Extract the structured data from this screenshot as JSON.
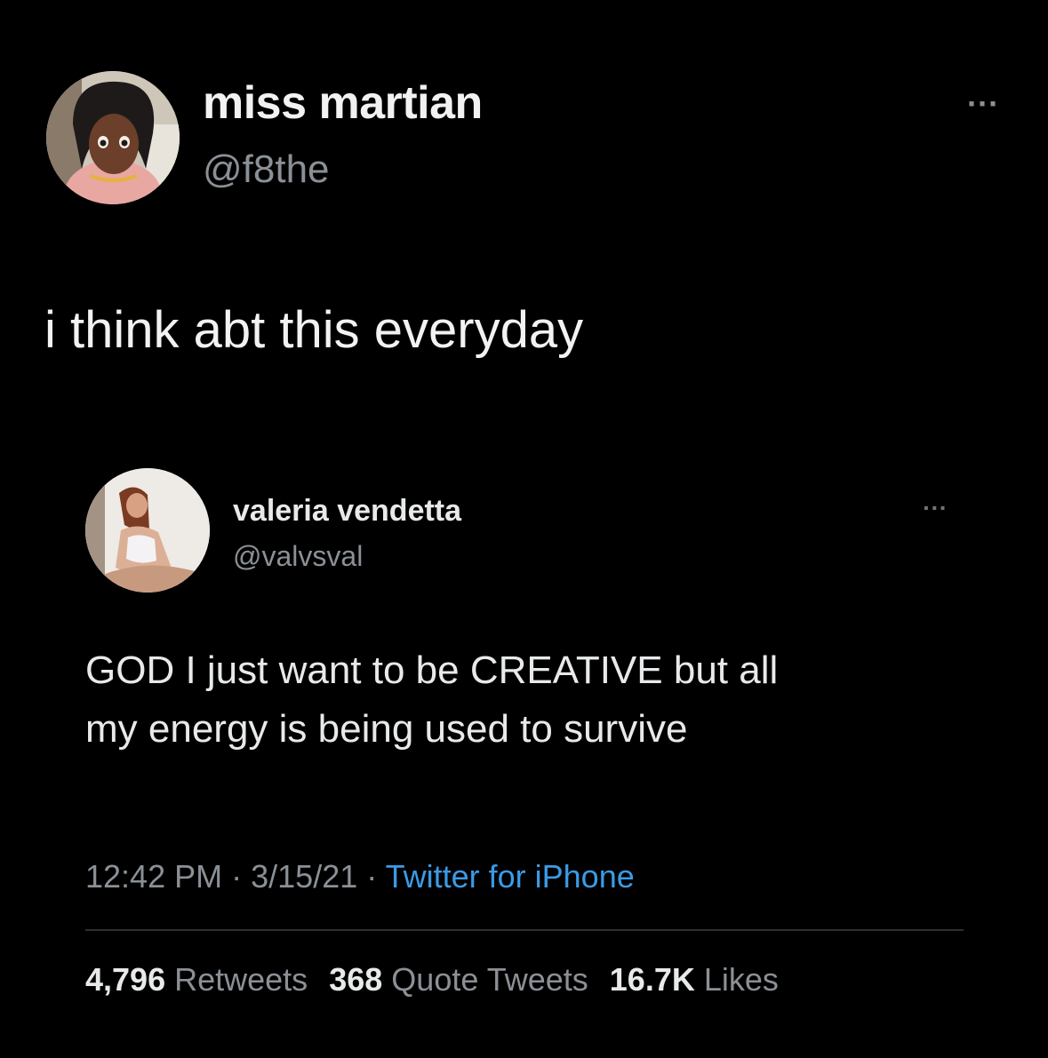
{
  "author": {
    "display_name": "miss martian",
    "handle": "@f8the",
    "avatar_description": "anime-style character avatar"
  },
  "tweet": {
    "text": "i think abt this everyday",
    "more_label": "···"
  },
  "quoted": {
    "display_name": "valeria vendetta",
    "handle": "@valvsval",
    "more_label": "···",
    "text_line1": "GOD I just want to be CREATIVE but all",
    "text_line2": "my energy is being used to survive",
    "time": "12:42 PM",
    "date": "3/15/21",
    "separator": "·",
    "source": "Twitter for iPhone",
    "stats": {
      "retweets_count": "4,796",
      "retweets_label": "Retweets",
      "quotes_count": "368",
      "quotes_label": "Quote Tweets",
      "likes_count": "16.7K",
      "likes_label": "Likes"
    }
  },
  "colors": {
    "background": "#000000",
    "primary_text": "#e7e9ea",
    "secondary_text": "#8b9096",
    "link": "#3a9be6"
  }
}
